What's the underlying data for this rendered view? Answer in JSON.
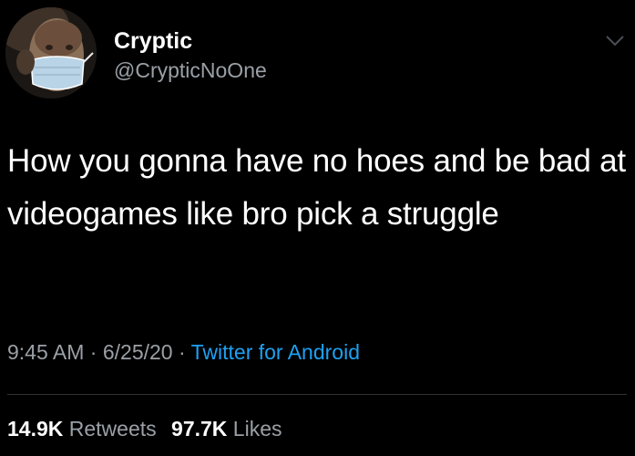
{
  "author": {
    "display_name": "Cryptic",
    "handle": "@CrypticNoOne",
    "avatar_icon": "avatar-man-with-face-mask"
  },
  "tweet": {
    "text": "How you gonna have no hoes and be bad at videogames like bro pick a struggle"
  },
  "meta": {
    "time": "9:45 AM",
    "sep1": " · ",
    "date": "6/25/20",
    "sep2": " · ",
    "source": "Twitter for Android"
  },
  "stats": {
    "retweets_count": "14.9K",
    "retweets_label": "Retweets",
    "likes_count": "97.7K",
    "likes_label": "Likes"
  },
  "colors": {
    "background": "#000000",
    "text": "#ffffff",
    "secondary": "#9aa0a6",
    "link": "#1da1f2"
  }
}
